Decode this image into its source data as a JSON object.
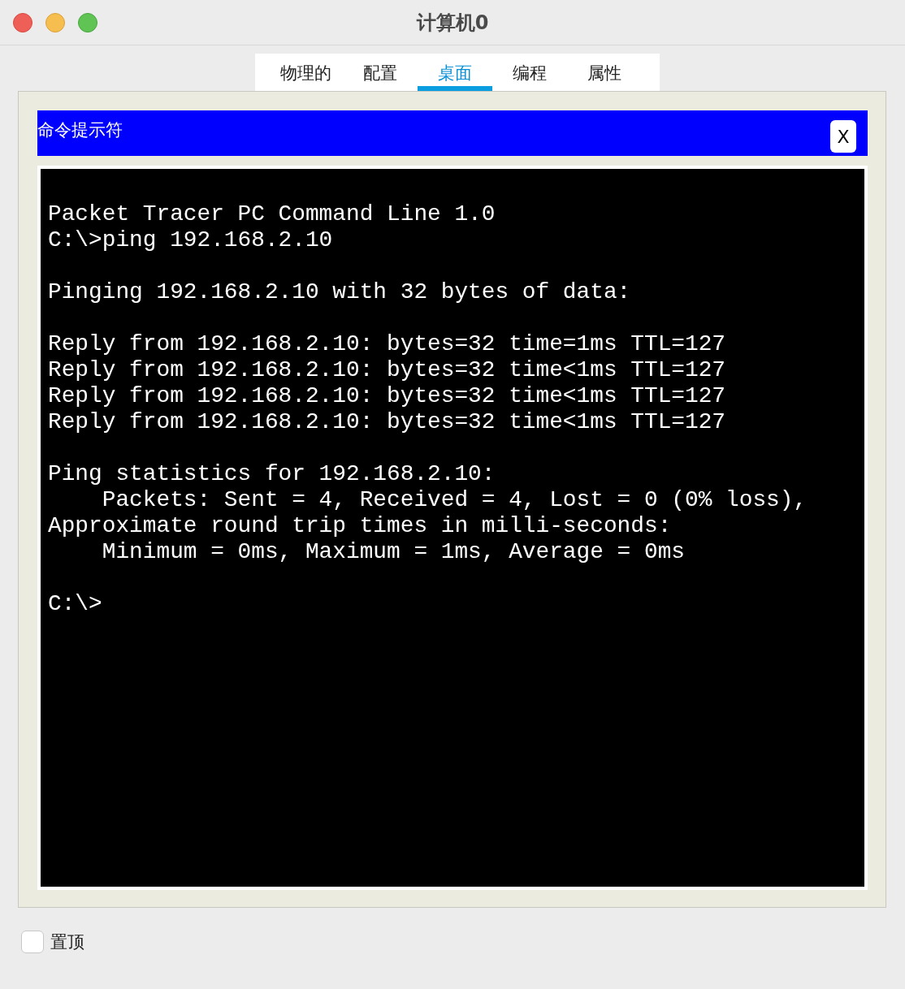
{
  "window": {
    "title": "计算机0"
  },
  "tabs": [
    {
      "label": "物理的",
      "selected": false
    },
    {
      "label": "配置",
      "selected": false
    },
    {
      "label": "桌面",
      "selected": true
    },
    {
      "label": "编程",
      "selected": false
    },
    {
      "label": "属性",
      "selected": false
    }
  ],
  "panel": {
    "title": "命令提示符",
    "close": "X"
  },
  "terminal": {
    "paragraphs": [
      [
        "Packet Tracer PC Command Line 1.0",
        "C:\\>ping 192.168.2.10"
      ],
      [
        "Pinging 192.168.2.10 with 32 bytes of data:"
      ],
      [
        "Reply from 192.168.2.10: bytes=32 time=1ms TTL=127",
        "Reply from 192.168.2.10: bytes=32 time<1ms TTL=127",
        "Reply from 192.168.2.10: bytes=32 time<1ms TTL=127",
        "Reply from 192.168.2.10: bytes=32 time<1ms TTL=127"
      ],
      [
        "Ping statistics for 192.168.2.10:",
        "    Packets: Sent = 4, Received = 4, Lost = 0 (0% loss),",
        "Approximate round trip times in milli-seconds:",
        "    Minimum = 0ms, Maximum = 1ms, Average = 0ms"
      ],
      [
        "C:\\>"
      ]
    ]
  },
  "always_on_top": {
    "label": "置顶",
    "checked": false
  }
}
